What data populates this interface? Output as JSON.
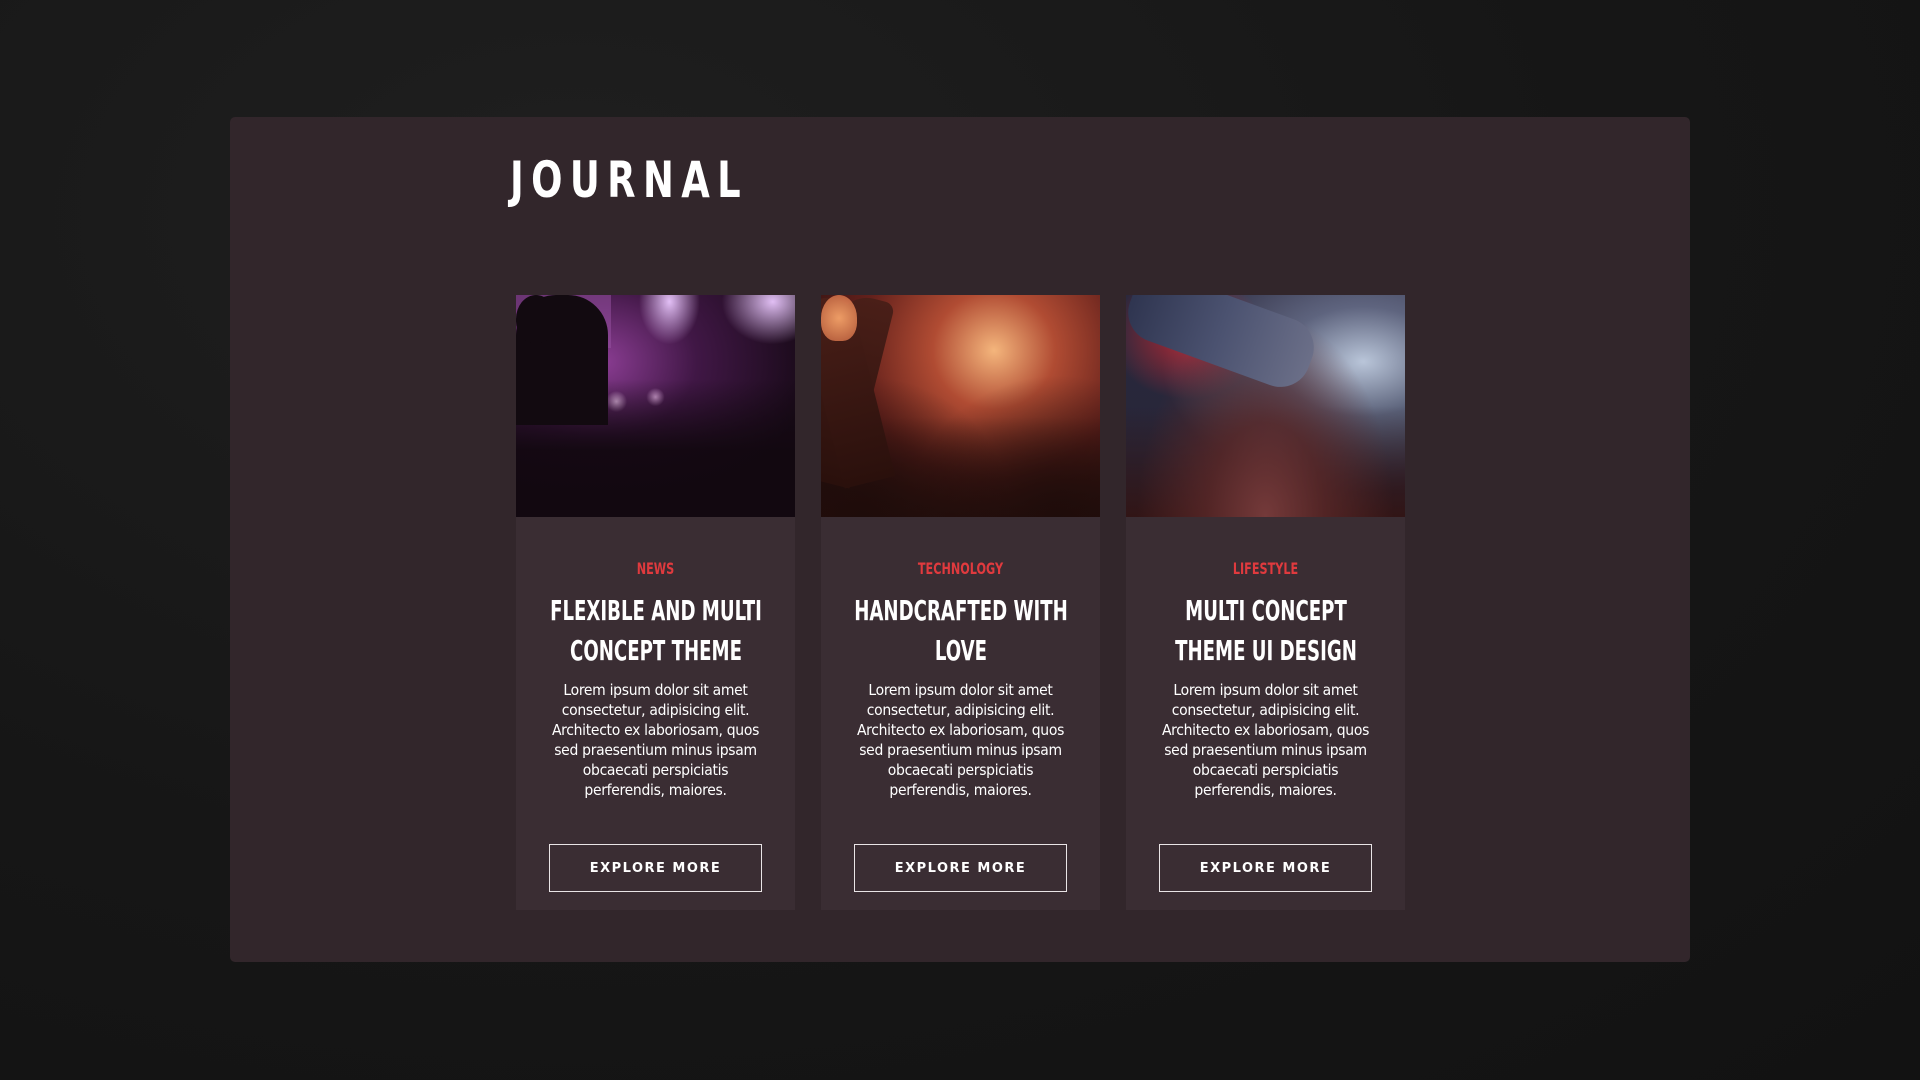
{
  "section": {
    "title": "JOURNAL"
  },
  "cards": [
    {
      "image": "concert-purple-silhouette",
      "category": "NEWS",
      "title": "FLEXIBLE AND MULTI CONCEPT THEME",
      "text": "Lorem ipsum dolor sit amet consectetur, adipisicing elit. Architecto ex laboriosam, quos sed praesentium minus ipsam obcaecati perspiciatis perferendis, maiores.",
      "button_label": "EXPLORE MORE"
    },
    {
      "image": "concert-heart-hands",
      "category": "TECHNOLOGY",
      "title": "HANDCRAFTED WITH LOVE",
      "text": "Lorem ipsum dolor sit amet consectetur, adipisicing elit. Architecto ex laboriosam, quos sed praesentium minus ipsam obcaecati perspiciatis perferendis, maiores.",
      "button_label": "EXPLORE MORE"
    },
    {
      "image": "concert-crowd-surfing",
      "category": "LIFESTYLE",
      "title": "MULTI CONCEPT THEME UI DESIGN",
      "text": "Lorem ipsum dolor sit amet consectetur, adipisicing elit. Architecto ex laboriosam, quos sed praesentium minus ipsam obcaecati perspiciatis perferendis, maiores.",
      "button_label": "EXPLORE MORE"
    }
  ],
  "colors": {
    "page_background": "#161616",
    "panel_background": "#32262b",
    "card_background": "#3a2d33",
    "category_accent": "#e03a3e",
    "text": "#ffffff",
    "button_border": "#e9e4e6"
  }
}
